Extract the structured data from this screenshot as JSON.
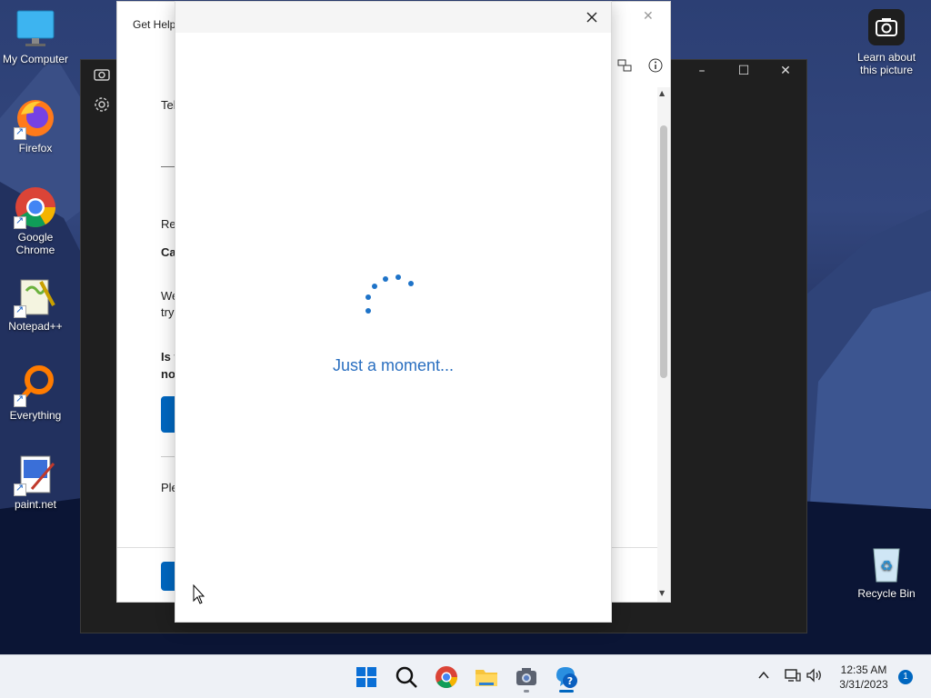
{
  "desktop": {
    "icons": [
      {
        "label": "My Computer",
        "icon": "monitor-icon"
      },
      {
        "label": "Firefox",
        "icon": "firefox-icon"
      },
      {
        "label": "Google Chrome",
        "icon": "chrome-icon"
      },
      {
        "label": "Notepad++",
        "icon": "notepadpp-icon"
      },
      {
        "label": "Everything",
        "icon": "everything-icon"
      },
      {
        "label": "paint.net",
        "icon": "paintnet-icon"
      }
    ],
    "learn_about": "Learn about this picture",
    "recycle_bin": "Recycle Bin"
  },
  "gethelp": {
    "title": "Get Help",
    "fragments": [
      "Tel",
      "Re",
      "Ca",
      "We",
      "try",
      "Is t",
      "no",
      "Ple"
    ]
  },
  "dialog": {
    "loading_text": "Just a moment..."
  },
  "taskbar": {
    "apps": [
      "start-icon",
      "search-icon",
      "chrome-icon",
      "file-explorer-icon",
      "camera-icon",
      "get-help-icon"
    ],
    "time": "12:35 AM",
    "date": "3/31/2023",
    "notification_count": "1"
  },
  "colors": {
    "accent": "#0067c0",
    "loading_text": "#2a6fc0",
    "spinner": "#1e73c8"
  }
}
